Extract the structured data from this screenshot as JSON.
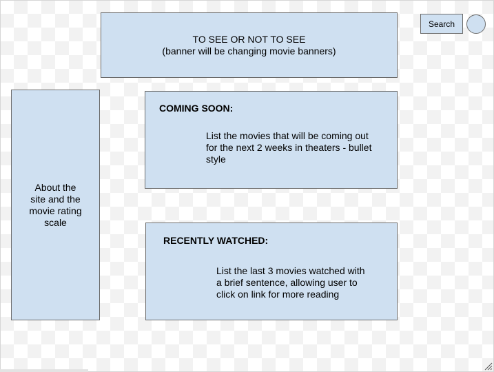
{
  "banner": {
    "line1": "TO SEE OR NOT TO SEE",
    "line2": "(banner will be changing movie banners)"
  },
  "search": {
    "label": "Search"
  },
  "about": {
    "text": "About the site and the movie rating scale"
  },
  "coming_soon": {
    "title": "COMING SOON:",
    "body": "List the movies that will be coming out for the next 2 weeks in theaters - bullet style"
  },
  "recently_watched": {
    "title": "RECENTLY WATCHED:",
    "body": "List the last 3 movies watched with a brief sentence, allowing user to click on link for more reading"
  },
  "colors": {
    "box_fill": "#cfe0f1",
    "box_border": "#6b6b6b"
  },
  "icons": {
    "profile": "profile-circle-icon",
    "resize": "resize-grip-icon"
  }
}
